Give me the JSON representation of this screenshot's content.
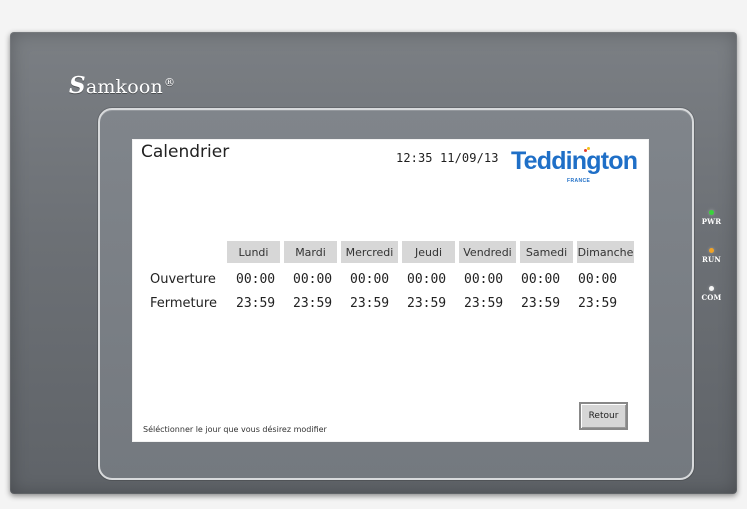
{
  "device": {
    "brand": {
      "initial": "S",
      "rest": "amkoon",
      "reg": "®"
    },
    "indicators": [
      {
        "label": "PWR",
        "color": "#39d33b"
      },
      {
        "label": "RUN",
        "color": "#f0a326"
      },
      {
        "label": "COM",
        "color": "#f5f5f5"
      }
    ]
  },
  "screen": {
    "title": "Calendrier",
    "datetime": "12:35 11/09/13",
    "logo": {
      "main": "Teddington",
      "sub": "FRANCE",
      "color": "#1f6fc7"
    },
    "days": [
      "Lundi",
      "Mardi",
      "Mercredi",
      "Jeudi",
      "Vendredi",
      "Samedi",
      "Dimanche"
    ],
    "rows": {
      "opening": {
        "label": "Ouverture",
        "times": [
          "00:00",
          "00:00",
          "00:00",
          "00:00",
          "00:00",
          "00:00",
          "00:00"
        ]
      },
      "closing": {
        "label": "Fermeture",
        "times": [
          "23:59",
          "23:59",
          "23:59",
          "23:59",
          "23:59",
          "23:59",
          "23:59"
        ]
      }
    },
    "instruction": "Séléctionner le jour que vous désirez modifier",
    "buttons": {
      "back": "Retour"
    }
  }
}
